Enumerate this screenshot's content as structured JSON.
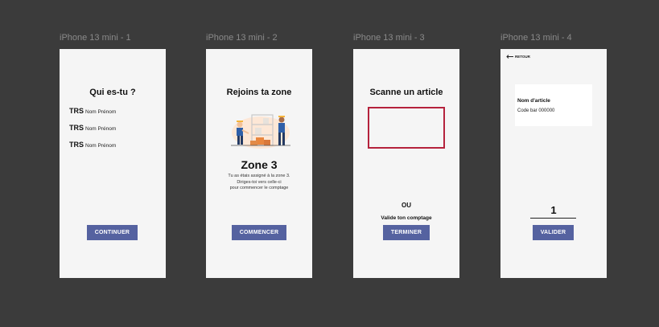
{
  "frames": [
    {
      "label": "iPhone 13 mini - 1",
      "title": "Qui es-tu ?",
      "users": [
        {
          "code": "TRS",
          "name": "Nom Prénom"
        },
        {
          "code": "TRS",
          "name": "Nom Prénom"
        },
        {
          "code": "TRS",
          "name": "Nom Prénom"
        }
      ],
      "button": "CONTINUER"
    },
    {
      "label": "iPhone 13 mini - 2",
      "title": "Rejoins ta zone",
      "zone": "Zone 3",
      "desc_lines": [
        "Tu as étais assigné à la zone 3.",
        "Diriges-toi vers celle-ci",
        "pour commencer le comptage"
      ],
      "button": "COMMENCER"
    },
    {
      "label": "iPhone 13 mini - 3",
      "title": "Scanne un article",
      "or_text": "OU",
      "validate_text": "Valide ton comptage",
      "button": "TERMINER"
    },
    {
      "label": "iPhone 13 mini - 4",
      "back": "RETOUR",
      "article_name": "Nom d'article",
      "article_code": "Code bar 000000",
      "quantity": "1",
      "button": "VALIDER"
    }
  ],
  "colors": {
    "background": "#3b3b3b",
    "frame": "#f5f5f5",
    "button": "#5562a0",
    "scanner_border": "#b5223c"
  },
  "icons": [
    "back-arrow-icon",
    "warehouse-workers-illustration"
  ]
}
